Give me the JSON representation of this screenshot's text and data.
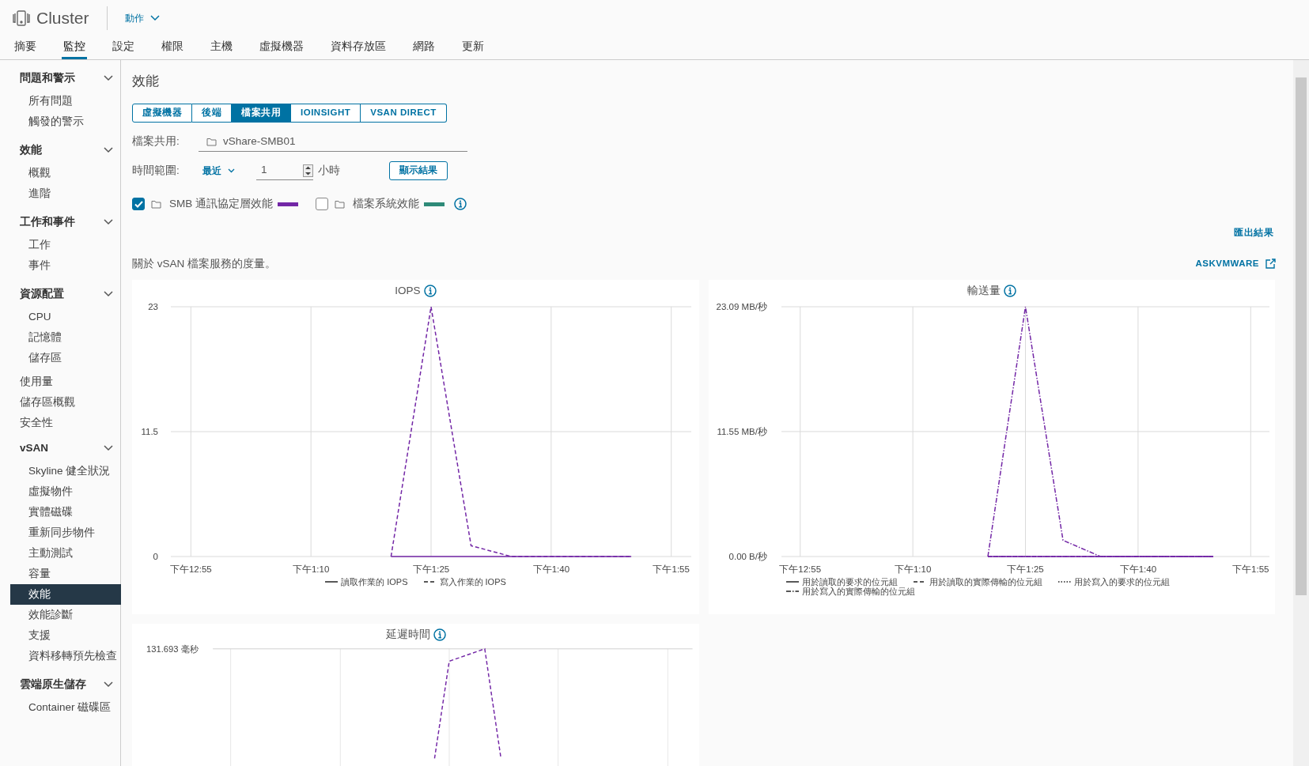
{
  "header": {
    "title": "Cluster",
    "actions_label": "動作"
  },
  "tabs": [
    {
      "label": "摘要",
      "selected": false
    },
    {
      "label": "監控",
      "selected": true
    },
    {
      "label": "設定",
      "selected": false
    },
    {
      "label": "權限",
      "selected": false
    },
    {
      "label": "主機",
      "selected": false
    },
    {
      "label": "虛擬機器",
      "selected": false
    },
    {
      "label": "資料存放區",
      "selected": false
    },
    {
      "label": "網路",
      "selected": false
    },
    {
      "label": "更新",
      "selected": false
    }
  ],
  "sidebar": {
    "items": [
      {
        "label": "問題和警示",
        "expanded": true,
        "children": [
          {
            "label": "所有問題",
            "selected": false
          },
          {
            "label": "觸發的警示",
            "selected": false
          }
        ]
      },
      {
        "label": "效能",
        "expanded": true,
        "children": [
          {
            "label": "概觀",
            "selected": false
          },
          {
            "label": "進階",
            "selected": false
          }
        ]
      },
      {
        "label": "工作和事件",
        "expanded": true,
        "children": [
          {
            "label": "工作",
            "selected": false
          },
          {
            "label": "事件",
            "selected": false
          }
        ]
      },
      {
        "label": "資源配置",
        "expanded": true,
        "children": [
          {
            "label": "CPU",
            "selected": false
          },
          {
            "label": "記憶體",
            "selected": false
          },
          {
            "label": "儲存區",
            "selected": false
          }
        ]
      },
      {
        "label": "使用量",
        "selected": false
      },
      {
        "label": "儲存區概觀",
        "selected": false
      },
      {
        "label": "安全性",
        "selected": false
      },
      {
        "label": "vSAN",
        "expanded": true,
        "children": [
          {
            "label": "Skyline 健全狀況",
            "selected": false
          },
          {
            "label": "虛擬物件",
            "selected": false
          },
          {
            "label": "實體磁碟",
            "selected": false
          },
          {
            "label": "重新同步物件",
            "selected": false
          },
          {
            "label": "主動測試",
            "selected": false
          },
          {
            "label": "容量",
            "selected": false
          },
          {
            "label": "效能",
            "selected": true
          },
          {
            "label": "效能診斷",
            "selected": false
          },
          {
            "label": "支援",
            "selected": false
          },
          {
            "label": "資料移轉預先檢查",
            "selected": false
          }
        ]
      },
      {
        "label": "雲端原生儲存",
        "expanded": true,
        "children": [
          {
            "label": "Container 磁碟區",
            "selected": false
          }
        ]
      }
    ]
  },
  "main": {
    "title": "效能",
    "segments": [
      {
        "label": "虛擬機器",
        "selected": false
      },
      {
        "label": "後端",
        "selected": false
      },
      {
        "label": "檔案共用",
        "selected": true
      },
      {
        "label": "IOINSIGHT",
        "selected": false
      },
      {
        "label": "VSAN DIRECT",
        "selected": false
      }
    ],
    "file_share": {
      "label": "檔案共用:",
      "value": "vShare-SMB01"
    },
    "time_range": {
      "label": "時間範圍:",
      "mode": "最近",
      "value": "1",
      "unit": "小時",
      "button": "顯示結果"
    },
    "series_toggles": [
      {
        "label": "SMB 通訊協定層效能",
        "checked": true,
        "color": "#7327a6"
      },
      {
        "label": "檔案系統效能",
        "checked": false,
        "color": "#2e8a78"
      }
    ],
    "export_link": "匯出結果",
    "description": "關於 vSAN 檔案服務的度量。",
    "askvmware_link": "ASKVMWARE",
    "charts": [
      {
        "title": "IOPS",
        "chart_data": {
          "type": "line",
          "grid": "both",
          "categories": [
            "下午12:55",
            null,
            null,
            "下午1:10",
            null,
            null,
            "下午1:25",
            null,
            null,
            "下午1:40",
            null,
            null,
            "下午1:55"
          ],
          "ylim": [
            0,
            23
          ],
          "yticks": [
            0,
            11.5,
            23
          ],
          "series": [
            {
              "name": "讀取作業的 IOPS",
              "color": "#7327a6",
              "line_style": "solid",
              "values": [
                null,
                null,
                null,
                null,
                null,
                0,
                0,
                0,
                0,
                0,
                0,
                0,
                null
              ]
            },
            {
              "name": "寫入作業的 IOPS",
              "color": "#7327a6",
              "line_style": "dashed",
              "values": [
                null,
                null,
                null,
                null,
                null,
                0,
                23,
                1,
                0,
                0,
                0,
                0,
                null
              ]
            }
          ]
        }
      },
      {
        "title": "輸送量",
        "chart_data": {
          "type": "line",
          "grid": "both",
          "categories": [
            "下午12:55",
            null,
            null,
            "下午1:10",
            null,
            null,
            "下午1:25",
            null,
            null,
            "下午1:40",
            null,
            null,
            "下午1:55"
          ],
          "ylim": [
            0,
            23.09
          ],
          "yticks": [
            {
              "value": 0,
              "label": "0.00 B/秒"
            },
            {
              "value": 11.55,
              "label": "11.55 MB/秒"
            },
            {
              "value": 23.09,
              "label": "23.09 MB/秒"
            }
          ],
          "series": [
            {
              "name": "用於讀取的要求的位元組",
              "color": "#7327a6",
              "line_style": "solid",
              "values": [
                null,
                null,
                null,
                null,
                null,
                0,
                0,
                0,
                0,
                0,
                0,
                0,
                null
              ]
            },
            {
              "name": "用於讀取的實際傳輸的位元組",
              "color": "#7327a6",
              "line_style": "dashed",
              "values": [
                null,
                null,
                null,
                null,
                null,
                0,
                0,
                0,
                0,
                0,
                0,
                0,
                null
              ]
            },
            {
              "name": "用於寫入的要求的位元組",
              "color": "#7327a6",
              "line_style": "dotted",
              "values": [
                null,
                null,
                null,
                null,
                null,
                0,
                0,
                0,
                0,
                0,
                0,
                0,
                null
              ]
            },
            {
              "name": "用於寫入的實際傳輸的位元組",
              "color": "#7327a6",
              "line_style": "dashdot",
              "values": [
                null,
                null,
                null,
                null,
                null,
                0,
                23.09,
                1.5,
                0,
                0,
                0,
                0,
                null
              ]
            }
          ]
        }
      }
    ],
    "latency": {
      "title": "延遲時間",
      "y_tick_label": "131.693 毫秒",
      "kind": "picture"
    }
  }
}
